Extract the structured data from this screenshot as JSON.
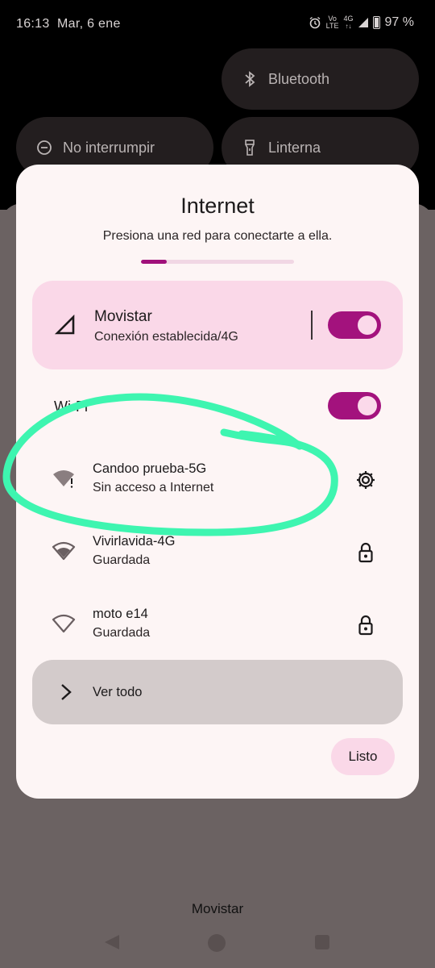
{
  "status_bar": {
    "time": "16:13",
    "date": "Mar, 6 ene",
    "volte_top": "Vo",
    "volte_bottom": "LTE",
    "network": "4G",
    "battery": "97 %"
  },
  "quick_tiles": {
    "bluetooth": "Bluetooth",
    "dnd": "No interrumpir",
    "flashlight": "Linterna"
  },
  "dialog": {
    "title": "Internet",
    "subtitle": "Presiona una red para conectarte a ella.",
    "progress_fraction": 0.17,
    "cellular": {
      "name": "Movistar",
      "status": "Conexión establecida/4G",
      "enabled": true
    },
    "wifi": {
      "label": "Wi-Fi",
      "enabled": true
    },
    "networks": [
      {
        "name": "Candoo prueba-5G",
        "status": "Sin acceso a Internet",
        "trailing_icon": "gear-icon"
      },
      {
        "name": "Vivirlavida-4G",
        "status": "Guardada",
        "trailing_icon": "lock-icon"
      },
      {
        "name": "moto e14",
        "status": "Guardada",
        "trailing_icon": "lock-icon"
      }
    ],
    "see_all": "Ver todo",
    "done": "Listo"
  },
  "carrier_label": "Movistar",
  "colors": {
    "accent": "#a3127d",
    "accent_container": "#fad8e8",
    "dialog_bg": "#fdf5f5",
    "annotation": "#3ef5b0"
  }
}
